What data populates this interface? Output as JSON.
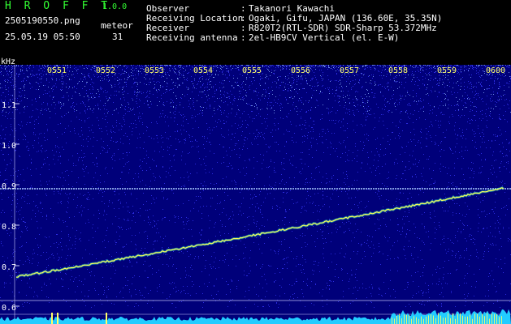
{
  "header": {
    "app_title": "H R O F F T",
    "app_version": "1.0.0",
    "file_name": "2505190550.png",
    "meteor_label": "meteor",
    "date_time": "25.05.19 05:50",
    "meteor_count": "31",
    "info": [
      {
        "label": "Observer",
        "value": "Takanori Kawachi"
      },
      {
        "label": "Receiving Location",
        "value": "Ogaki, Gifu, JAPAN (136.60E, 35.35N)"
      },
      {
        "label": "Receiver",
        "value": "R820T2(RTL-SDR) SDR-Sharp 53.372MHz"
      },
      {
        "label": "Receiving antenna",
        "value": "2el-HB9CV Vertical (el. E-W)"
      }
    ],
    "colon": ":"
  },
  "spectrogram": {
    "unit_label": "kHz",
    "y_ticks": [
      "1.1",
      "1.0",
      "0.9",
      "0.8",
      "0.7",
      "0.6"
    ],
    "time_ticks": [
      "0551",
      "0552",
      "0553",
      "0554",
      "0555",
      "0556",
      "0557",
      "0558",
      "0559",
      "0600"
    ],
    "colors": {
      "background": "#00007a",
      "noise": "#3a3aff",
      "trace": "#ffff55",
      "trace_glow": "#33ffcc",
      "carrier": "#aaccff",
      "grid": "#ccccff",
      "baseline": "#22ccff",
      "time_ticks": "#ffff66"
    }
  }
}
